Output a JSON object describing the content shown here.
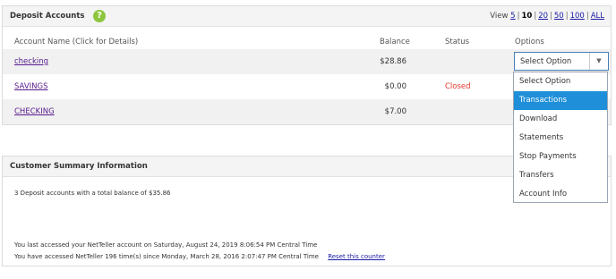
{
  "deposit": {
    "title": "Deposit Accounts",
    "help_icon": "?",
    "view": {
      "prefix": "View",
      "options": [
        "5",
        "10",
        "20",
        "50",
        "100",
        "ALL"
      ],
      "current": "10"
    },
    "columns": {
      "name": "Account Name (Click for Details)",
      "balance": "Balance",
      "status": "Status",
      "options": "Options"
    },
    "rows": [
      {
        "name": "checking",
        "balance": "$28.86",
        "status": ""
      },
      {
        "name": "SAVINGS",
        "balance": "$0.00",
        "status": "Closed"
      },
      {
        "name": "CHECKING",
        "balance": "$7.00",
        "status": ""
      }
    ],
    "select": {
      "value": "Select Option",
      "arrow": "▼",
      "options": [
        "Select Option",
        "Transactions",
        "Download",
        "Statements",
        "Stop Payments",
        "Transfers",
        "Account Info"
      ],
      "highlighted": "Transactions"
    }
  },
  "summary": {
    "title": "Customer Summary Information",
    "total_text": "3 Deposit accounts with a total balance of $35.86",
    "last_access": "You last accessed your NetTeller account on Saturday, August 24, 2019 8:06:54 PM Central Time",
    "access_count": "You have accessed NetTeller 196 time(s) since Monday, March 28, 2016 2:07:47 PM Central Time",
    "reset_link": "Reset this counter"
  },
  "colors": {
    "help_green": "#8cc63f",
    "highlight_blue": "#1e8fd8",
    "closed_red": "#e0382e",
    "link_blue": "#1a1aa6"
  }
}
